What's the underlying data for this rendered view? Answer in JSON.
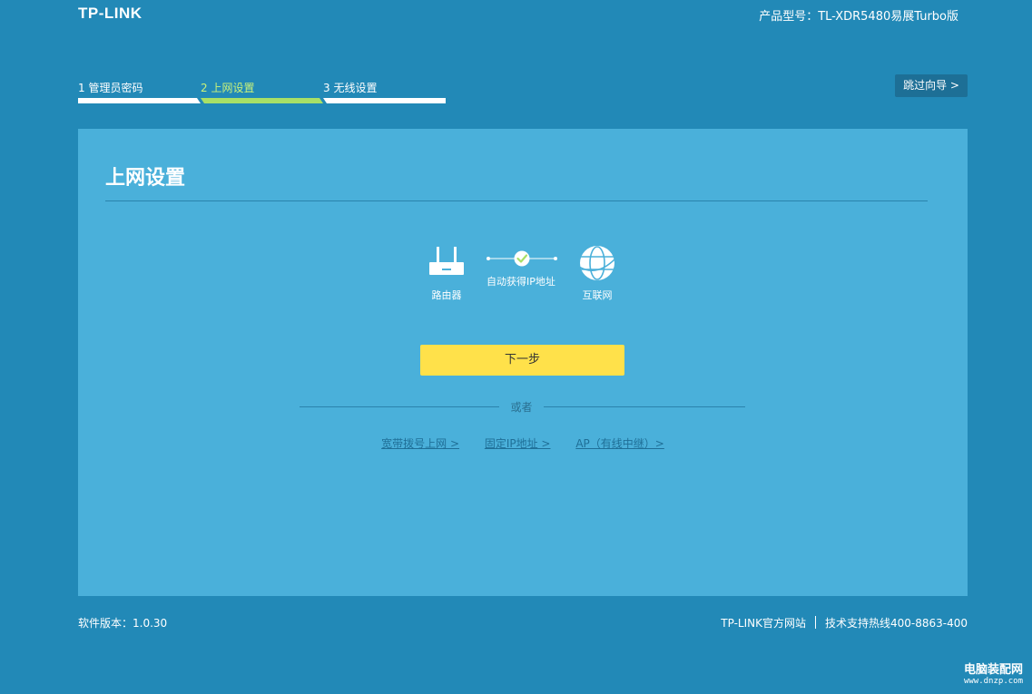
{
  "header": {
    "logo": "TP-LINK",
    "model": "产品型号：TL-XDR5480易展Turbo版"
  },
  "wizard": {
    "steps": [
      {
        "label": "1 管理员密码",
        "active": false
      },
      {
        "label": "2 上网设置",
        "active": true
      },
      {
        "label": "3 无线设置",
        "active": false
      }
    ],
    "skip_label": "跳过向导 >"
  },
  "panel": {
    "title": "上网设置",
    "diagram": {
      "router_label": "路由器",
      "link_label": "自动获得IP地址",
      "internet_label": "互联网",
      "icons": [
        "router-icon",
        "check-circle-icon",
        "globe-icon"
      ]
    },
    "next_button": "下一步",
    "or_text": "或者",
    "alt_links": [
      "宽带拨号上网 >",
      "固定IP地址 >",
      "AP（有线中继）>"
    ]
  },
  "footer": {
    "version": "软件版本：1.0.30",
    "official_site": "TP-LINK官方网站",
    "hotline": "技术支持热线400-8863-400"
  },
  "watermark": {
    "title": "电脑装配网",
    "url": "www.dnzp.com"
  },
  "colors": {
    "background": "#2289b7",
    "panel": "#4ab0da",
    "active_step": "#a8e067",
    "next_button": "#ffe14a",
    "check": "#a8e067",
    "link": "#1f6f97"
  }
}
